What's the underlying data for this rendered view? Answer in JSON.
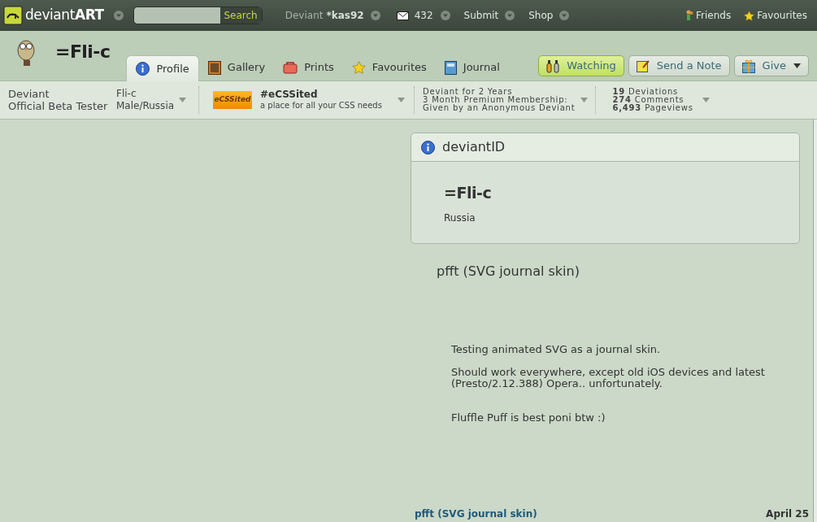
{
  "topbar": {
    "logo": "deviant**ART**",
    "search": {
      "button": "Search"
    },
    "user": {
      "label": "Deviant",
      "name": "*kas92"
    },
    "messages": "432",
    "menus": [
      "Submit",
      "Shop"
    ],
    "links": [
      {
        "kind": "friends",
        "label": "Friends"
      },
      {
        "kind": "favourites",
        "label": "Favourites"
      }
    ]
  },
  "profile": {
    "name": "=Fli-c"
  },
  "tabs": [
    {
      "kind": "info",
      "label": "Profile",
      "selected": true
    },
    {
      "kind": "gallery",
      "label": "Gallery",
      "selected": false
    },
    {
      "kind": "prints",
      "label": "Prints",
      "selected": false
    },
    {
      "kind": "star",
      "label": "Favourites",
      "selected": false
    },
    {
      "kind": "journal",
      "label": "Journal",
      "selected": false
    }
  ],
  "actions": [
    {
      "kind": "watch",
      "label": "Watching",
      "selected": true
    },
    {
      "kind": "note",
      "label": "Send a Note",
      "selected": false
    },
    {
      "kind": "give",
      "label": "Give",
      "selected": false
    }
  ],
  "info_bar": {
    "rank": [
      "Deviant",
      "Official Beta Tester"
    ],
    "identity": [
      "Fli-c",
      "Male/Russia"
    ],
    "group": {
      "badge": "eCSSited",
      "name": "#eCSSited",
      "tagline": "a place for all your CSS needs"
    },
    "membership": [
      "Deviant for 2 Years",
      "3 Month Premium Membership:",
      "Given by an Anonymous Deviant"
    ],
    "stats": [
      {
        "number": "19",
        "label": "Deviations"
      },
      {
        "number": "274",
        "label": "Comments"
      },
      {
        "number": "6,493",
        "label": "Pageviews"
      }
    ]
  },
  "deviant_id": {
    "title": "deviantID",
    "name": "=Fli-c",
    "location": "Russia"
  },
  "journal": {
    "title": "pfft (SVG journal skin)",
    "paragraphs": [
      "Testing animated SVG as a journal skin.",
      "Should work everywhere, except old iOS devices and latest (Presto/2.12.388) Opera.. unfortunately.",
      "Fluffle Puff is best poni btw :)"
    ],
    "footer_link": "pfft (SVG journal skin)",
    "date": "April 25"
  }
}
